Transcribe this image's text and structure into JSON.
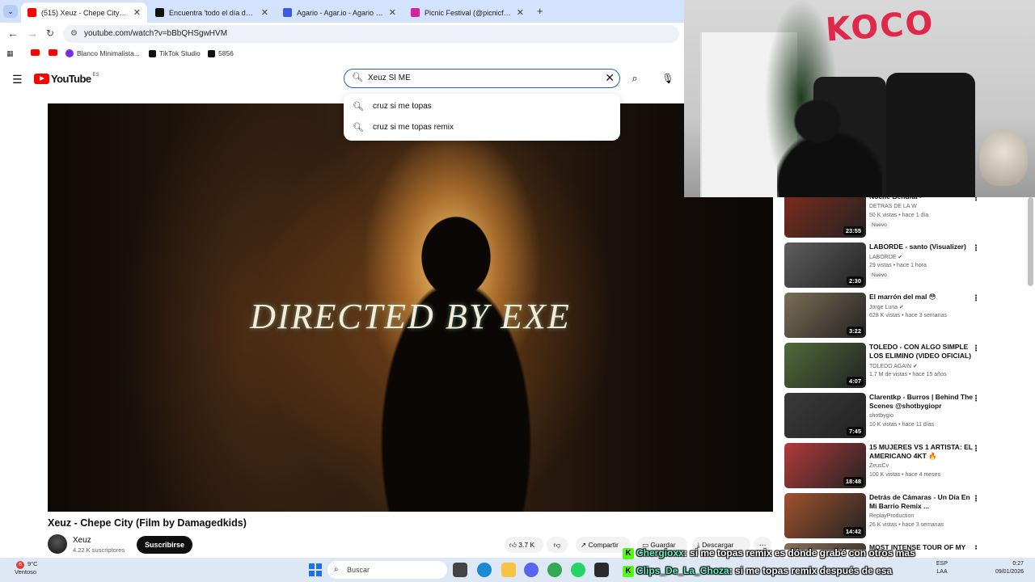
{
  "browser": {
    "tabs": [
      {
        "title": "(515) Xeuz - Chepe City (Film b",
        "active": true,
        "favicon_color": "#ff0000"
      },
      {
        "title": "Encuentra 'todo el día de 4bes'",
        "active": false,
        "favicon_color": "#111111"
      },
      {
        "title": "Agario - Agar.io - Agario Juego",
        "active": false,
        "favicon_color": "#3b5bdb"
      },
      {
        "title": "Picnic Festival (@picnicfest) • Fo",
        "active": false,
        "favicon_color": "#d6249f"
      }
    ],
    "url": "youtube.com/watch?v=bBbQHSgwHVM",
    "bookmarks": [
      {
        "label": "",
        "icon": "youtube-icon"
      },
      {
        "label": "",
        "icon": "youtube-icon"
      },
      {
        "label": "Blanco Minimalista...",
        "icon": "canva-icon"
      },
      {
        "label": "TikTok Studio",
        "icon": "tiktok-icon"
      },
      {
        "label": "5856",
        "icon": "tiktok-icon"
      }
    ]
  },
  "youtube": {
    "logo_text": "YouTube",
    "region": "ES",
    "search": {
      "value": "Xeuz SI ME",
      "suggestions": [
        "cruz si me topas",
        "cruz si me topas remix"
      ]
    },
    "video": {
      "overlay_text": "DIRECTED BY EXE",
      "title": "Xeuz - Chepe City (Film by Damagedkids)",
      "channel": "Xeuz",
      "subscribers": "4.22 K suscriptores",
      "subscribe_label": "Suscribirse",
      "likes": "3.7 K",
      "share_label": "Compartir",
      "save_label": "Guardar",
      "download_label": "Descargar"
    },
    "recommendations": [
      {
        "title": "Noche Bendita -",
        "channel": "DETRAS DE LA W",
        "views": "50 K vistas",
        "age": "hace 1 día",
        "duration": "23:55",
        "badge": "Nuevo",
        "thumb": "#7d2b1c",
        "verified": false
      },
      {
        "title": "LABORDE - santo (Visualizer)",
        "channel": "LABORDE",
        "views": "29 vistas",
        "age": "hace 1 hora",
        "duration": "2:30",
        "badge": "Nuevo",
        "thumb": "#5e5e5e",
        "verified": true
      },
      {
        "title": "El marrón del mal 😳",
        "channel": "Jorge Luna",
        "views": "628 K vistas",
        "age": "hace 3 semanas",
        "duration": "3:22",
        "badge": "",
        "thumb": "#7a6f55",
        "verified": true
      },
      {
        "title": "TOLEDO - CON ALGO SIMPLE LOS ELIMINO (VIDEO OFICIAL)",
        "channel": "TOLEDO AGAIN",
        "views": "1.7 M de vistas",
        "age": "hace 15 años",
        "duration": "4:07",
        "badge": "",
        "thumb": "#4f6b3a",
        "verified": true
      },
      {
        "title": "Clarentkp - Burros | Behind The Scenes @shotbygiopr",
        "channel": "shotbygio",
        "views": "10 K vistas",
        "age": "hace 11 días",
        "duration": "7:45",
        "badge": "",
        "thumb": "#3a3a3a",
        "verified": false
      },
      {
        "title": "15 MUJERES VS 1 ARTISTA: EL AMERICANO 4KT 🔥",
        "channel": "ZeusCv",
        "views": "100 K vistas",
        "age": "hace 4 meses",
        "duration": "18:48",
        "badge": "",
        "thumb": "#b33a3a",
        "verified": false
      },
      {
        "title": "Detrás de Cámaras - Un Día En Mi Barrio Remix ...",
        "channel": "ReplayProduction",
        "views": "26 K vistas",
        "age": "hace 3 semanas",
        "duration": "14:42",
        "badge": "",
        "thumb": "#a0522d",
        "verified": false
      },
      {
        "title": "MOST INTENSE TOUR OF MY LIFE!!! PRIVATE JETS, GENDE...",
        "channel": "",
        "views": "",
        "age": "",
        "duration": "",
        "badge": "",
        "thumb": "#8a6e5a",
        "verified": false
      }
    ]
  },
  "webcam": {
    "graffiti": "KOCO"
  },
  "chat": [
    {
      "user": "Chergioxx",
      "message": ": si me topas remix es dónde grabé con otros mas"
    },
    {
      "user": "Clips_De_La_Choza",
      "message": ": si me topas remix después de esa"
    }
  ],
  "taskbar": {
    "weather_temp": "9°C",
    "weather_desc": "Ventoso",
    "weather_badge": "6",
    "search_placeholder": "Buscar",
    "lang_top": "ESP",
    "lang_bottom": "LAA",
    "time": "0:27",
    "date": "09/01/2026"
  },
  "colors": {
    "accent": "#1c62b9",
    "youtube_red": "#ff0000",
    "chat_user": "#62f2c8",
    "kick_green": "#53fc18"
  }
}
